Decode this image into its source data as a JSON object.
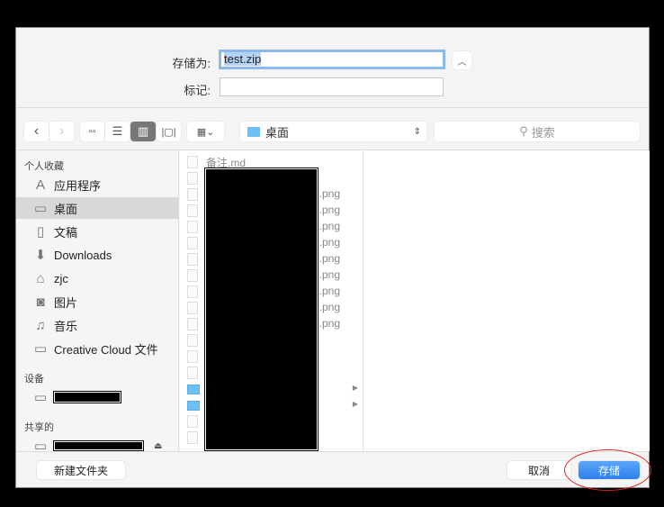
{
  "save_as": {
    "label": "存储为:",
    "value": "test.zip"
  },
  "tags": {
    "label": "标记:",
    "value": ""
  },
  "toolbar": {
    "location": "桌面",
    "search_placeholder": "搜索"
  },
  "sidebar": {
    "favorites_header": "个人收藏",
    "favorites": [
      {
        "label": "应用程序",
        "icon": "apps-icon"
      },
      {
        "label": "桌面",
        "icon": "desktop-icon",
        "selected": true
      },
      {
        "label": "文稿",
        "icon": "documents-icon"
      },
      {
        "label": "Downloads",
        "icon": "downloads-icon"
      },
      {
        "label": "zjc",
        "icon": "home-icon"
      },
      {
        "label": "图片",
        "icon": "camera-icon"
      },
      {
        "label": "音乐",
        "icon": "music-icon"
      },
      {
        "label": "Creative Cloud 文件",
        "icon": "folder-icon"
      }
    ],
    "devices_header": "设备",
    "shared_header": "共享的"
  },
  "files": [
    {
      "name": "备注.md",
      "type": "file"
    },
    {
      "name": "",
      "type": "file"
    },
    {
      "name": ".png",
      "type": "file"
    },
    {
      "name": ".png",
      "type": "file"
    },
    {
      "name": ".png",
      "type": "file"
    },
    {
      "name": ".png",
      "type": "file"
    },
    {
      "name": ".png",
      "type": "file"
    },
    {
      "name": ".png",
      "type": "file"
    },
    {
      "name": ".png",
      "type": "file"
    },
    {
      "name": ".png",
      "type": "file"
    },
    {
      "name": ".png",
      "type": "file"
    },
    {
      "name": "",
      "type": "file"
    },
    {
      "name": "",
      "type": "file"
    },
    {
      "name": "",
      "type": "file"
    },
    {
      "name": "",
      "type": "folder"
    },
    {
      "name": "",
      "type": "folder"
    },
    {
      "name": "",
      "type": "file"
    },
    {
      "name": "",
      "type": "file"
    }
  ],
  "footer": {
    "new_folder": "新建文件夹",
    "cancel": "取消",
    "save": "存储"
  },
  "colors": {
    "accent": "#3d8ff0",
    "annotation": "#e02020"
  }
}
